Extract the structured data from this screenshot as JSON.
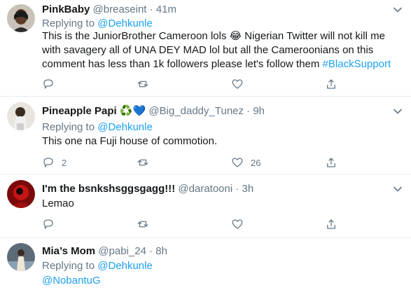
{
  "tweets": [
    {
      "name": "PinkBaby",
      "handle": "@breaseint",
      "dot": "·",
      "time": "41m",
      "replying_prefix": "Replying to",
      "replying_to": "@Dehkunle",
      "text_line1": "This is the JuniorBrother Cameroon lols 😂 Nigerian Twitter will not kill me",
      "text_line2": "with savagery all of UNA DEY MAD lol but all the Cameroonians on this",
      "text_line3_pre": "comment has less than 1k followers please let's follow them ",
      "hashtag": "#BlackSupport",
      "reply_count": "",
      "like_count": ""
    },
    {
      "name": "Pineapple Papi",
      "emoji": "♻️💙",
      "handle": "@Big_daddy_Tunez",
      "dot": "·",
      "time": "9h",
      "replying_prefix": "Replying to",
      "replying_to": "@Dehkunle",
      "text_line1": "This one na Fuji house of commotion.",
      "reply_count": "2",
      "like_count": "26"
    },
    {
      "name": "I'm the bsnkshsggsgagg!!!",
      "handle": "@daratooni",
      "dot": "·",
      "time": "3h",
      "text_line1": "Lemao",
      "reply_count": "",
      "like_count": ""
    },
    {
      "name": "Mia’s Mom",
      "handle": "@pabi_24",
      "dot": "·",
      "time": "8h",
      "replying_prefix": "Replying to",
      "replying_to": "@Dehkunle",
      "mention": "@NobantuG"
    }
  ],
  "icons": {
    "reply": "reply-icon",
    "retweet": "retweet-icon",
    "like": "heart-icon",
    "share": "share-icon",
    "caret": "chevron-down-icon"
  },
  "colors": {
    "link": "#1da1f2",
    "secondary_text": "#657786",
    "primary_text": "#14171a",
    "divider": "#e6ecf0"
  }
}
